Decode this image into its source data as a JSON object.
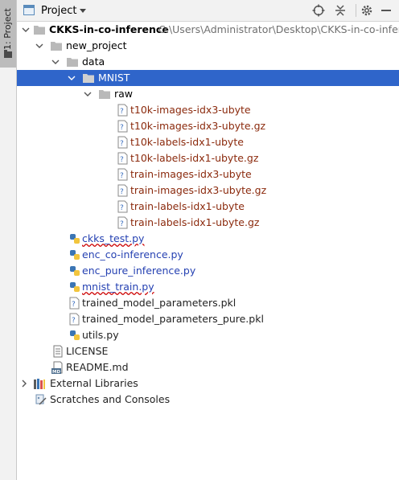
{
  "sidebar": {
    "tab_label": "1: Project"
  },
  "header": {
    "title": "Project"
  },
  "tree": {
    "root": {
      "name": "CKKS-in-co-inference",
      "path": "C:\\Users\\Administrator\\Desktop\\CKKS-in-co-inference"
    },
    "new_project": "new_project",
    "data": "data",
    "mnist": "MNIST",
    "raw": "raw",
    "raw_files": [
      "t10k-images-idx3-ubyte",
      "t10k-images-idx3-ubyte.gz",
      "t10k-labels-idx1-ubyte",
      "t10k-labels-idx1-ubyte.gz",
      "train-images-idx3-ubyte",
      "train-images-idx3-ubyte.gz",
      "train-labels-idx1-ubyte",
      "train-labels-idx1-ubyte.gz"
    ],
    "py_files": [
      "ckks_test.py",
      "enc_co-inference.py",
      "enc_pure_inference.py",
      "mnist_train.py"
    ],
    "pkl_files": [
      "trained_model_parameters.pkl",
      "trained_model_parameters_pure.pkl"
    ],
    "utils": "utils.py",
    "license": "LICENSE",
    "readme": "README.md",
    "readme_badge": "MD",
    "external": "External Libraries",
    "scratches": "Scratches and Consoles"
  },
  "colors": {
    "selection": "#2f65ca",
    "file_unversioned": "#8b2a0d",
    "file_modified": "#2541b2",
    "folder": "#b9b9b9"
  }
}
